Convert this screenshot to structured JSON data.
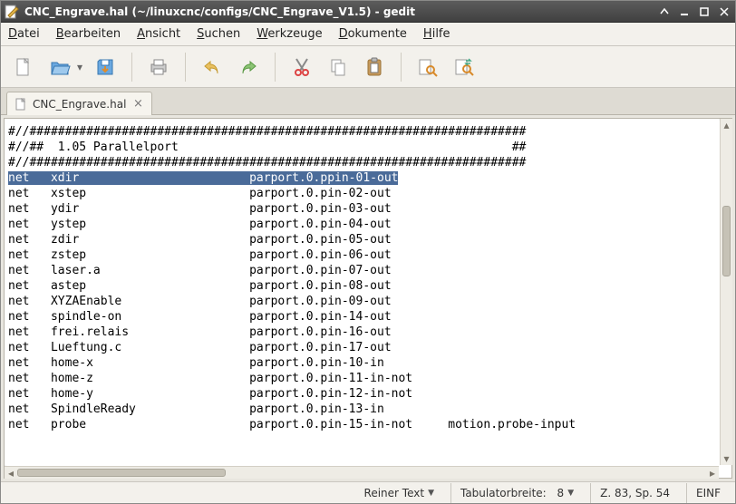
{
  "window": {
    "title": "CNC_Engrave.hal (~/linuxcnc/configs/CNC_Engrave_V1.5) - gedit"
  },
  "menu": {
    "file": {
      "label": "Datei",
      "accel": "D"
    },
    "edit": {
      "label": "Bearbeiten",
      "accel": "B"
    },
    "view": {
      "label": "Ansicht",
      "accel": "A"
    },
    "search": {
      "label": "Suchen",
      "accel": "S"
    },
    "tools": {
      "label": "Werkzeuge",
      "accel": "W"
    },
    "docs": {
      "label": "Dokumente",
      "accel": "D"
    },
    "help": {
      "label": "Hilfe",
      "accel": "H"
    }
  },
  "tabs": [
    {
      "label": "CNC_Engrave.hal"
    }
  ],
  "editor_lines": [
    "#//######################################################################",
    "#//##  1.05 Parallelport                                               ##",
    "#//######################################################################",
    "net   xdir                        parport.0.ppin-01-out",
    "net   xstep                       parport.0.pin-02-out",
    "net   ydir                        parport.0.pin-03-out",
    "net   ystep                       parport.0.pin-04-out",
    "net   zdir                        parport.0.pin-05-out",
    "net   zstep                       parport.0.pin-06-out",
    "net   laser.a                     parport.0.pin-07-out",
    "net   astep                       parport.0.pin-08-out",
    "net   XYZAEnable                  parport.0.pin-09-out",
    "net   spindle-on                  parport.0.pin-14-out",
    "net   frei.relais                 parport.0.pin-16-out",
    "net   Lueftung.c                  parport.0.pin-17-out",
    "net   home-x                      parport.0.pin-10-in",
    "net   home-z                      parport.0.pin-11-in-not",
    "net   home-y                      parport.0.pin-12-in-not",
    "net   SpindleReady                parport.0.pin-13-in",
    "net   probe                       parport.0.pin-15-in-not     motion.probe-input"
  ],
  "selected_line_index": 3,
  "statusbar": {
    "lang_label": "Reiner Text",
    "tabwidth_label": "Tabulatorbreite:",
    "tabwidth_value": "8",
    "cursor": "Z. 83, Sp. 54",
    "insert_mode": "EINF"
  },
  "icons": {
    "new_doc": "new-file-icon",
    "open": "open-folder-icon",
    "save": "save-icon",
    "print": "print-icon",
    "undo": "undo-icon",
    "redo": "redo-icon",
    "cut": "cut-icon",
    "copy": "copy-icon",
    "paste": "paste-icon",
    "find": "find-icon",
    "replace": "replace-icon"
  }
}
